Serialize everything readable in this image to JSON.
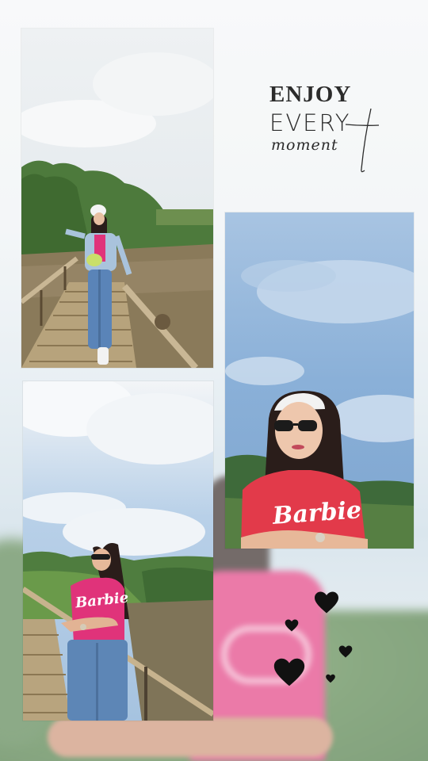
{
  "story": {
    "headline_line1": "ENJOY",
    "headline_line2": "EVERY",
    "headline_line3": "moment",
    "shirt_text": "Barbie"
  },
  "colors": {
    "text_dark": "#2b2b2b",
    "shirt_pink": "#e0337a",
    "sky_blue": "#8fb2d6",
    "foliage_green": "#4f7d47",
    "heart_black": "#111111"
  },
  "icons": [
    "heart-icon"
  ]
}
